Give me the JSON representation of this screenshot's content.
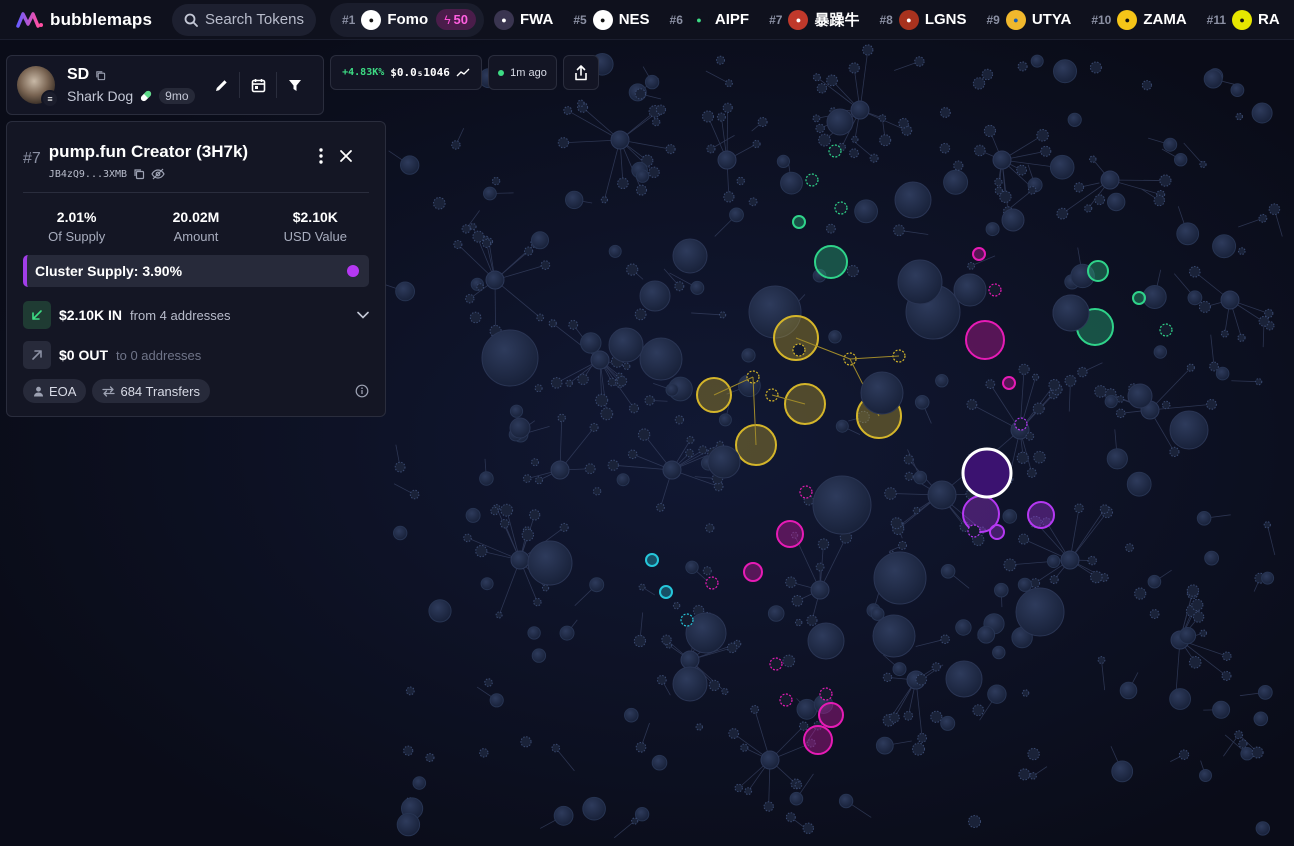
{
  "app": {
    "brand": "bubblemaps",
    "search_placeholder": "Search Tokens"
  },
  "trending": [
    {
      "rank": "#1",
      "name": "Fomo",
      "logo_bg": "#ffffff",
      "logo_fg": "#111111",
      "logo_icon": "fomo-logo-icon",
      "boost": "50",
      "active": true
    },
    {
      "rank": "",
      "name": "FWA",
      "logo_bg": "#3a3550",
      "logo_fg": "#ffffff",
      "logo_icon": "fwa-logo-icon"
    },
    {
      "rank": "#5",
      "name": "NES",
      "logo_bg": "#ffffff",
      "logo_fg": "#111111",
      "logo_icon": "nes-logo-icon"
    },
    {
      "rank": "#6",
      "name": "AIPF",
      "logo_bg": "#0f111d",
      "logo_fg": "#3ddc84",
      "logo_icon": "aipf-logo-icon"
    },
    {
      "rank": "#7",
      "name": "暴躁牛",
      "logo_bg": "#c0392b",
      "logo_fg": "#ffffff",
      "logo_icon": "bull-logo-icon"
    },
    {
      "rank": "#8",
      "name": "LGNS",
      "logo_bg": "#a8321e",
      "logo_fg": "#ffffff",
      "logo_icon": "lgns-logo-icon"
    },
    {
      "rank": "#9",
      "name": "UTYA",
      "logo_bg": "#f0b82d",
      "logo_fg": "#1a5fb4",
      "logo_icon": "utya-logo-icon"
    },
    {
      "rank": "#10",
      "name": "ZAMA",
      "logo_bg": "#f5c518",
      "logo_fg": "#111111",
      "logo_icon": "zama-logo-icon"
    },
    {
      "rank": "#11",
      "name": "RA",
      "logo_bg": "#e6e600",
      "logo_fg": "#111111",
      "logo_icon": "ra-logo-icon"
    }
  ],
  "token": {
    "symbol": "SD",
    "name": "Shark Dog",
    "age": "9mo",
    "change": "+4.83K%",
    "price": "$0.0₅1046",
    "updated": "1m ago"
  },
  "wallet": {
    "rank": "#7",
    "title": "pump.fun Creator (3H7k)",
    "address": "JB4zQ9...3XMB",
    "stats": [
      {
        "value": "2.01%",
        "label": "Of Supply"
      },
      {
        "value": "20.02M",
        "label": "Amount"
      },
      {
        "value": "$2.10K",
        "label": "USD Value"
      }
    ],
    "cluster_supply": "Cluster Supply: 3.90%",
    "inflow": {
      "amount": "$2.10K IN",
      "detail": "from 4 addresses"
    },
    "outflow": {
      "amount": "$0 OUT",
      "detail": "to 0 addresses"
    },
    "tags": [
      {
        "label": "EOA",
        "icon": "user-icon"
      },
      {
        "label": "684 Transfers",
        "icon": "transfer-icon"
      }
    ]
  },
  "colors": {
    "accent_purple": "#b538f2",
    "yellow_cluster": "#d4b52a",
    "green_cluster": "#2fd38a",
    "magenta_cluster": "#e61bb5",
    "cyan_cluster": "#26c6da",
    "neutral_bubble": "#1e2740"
  }
}
